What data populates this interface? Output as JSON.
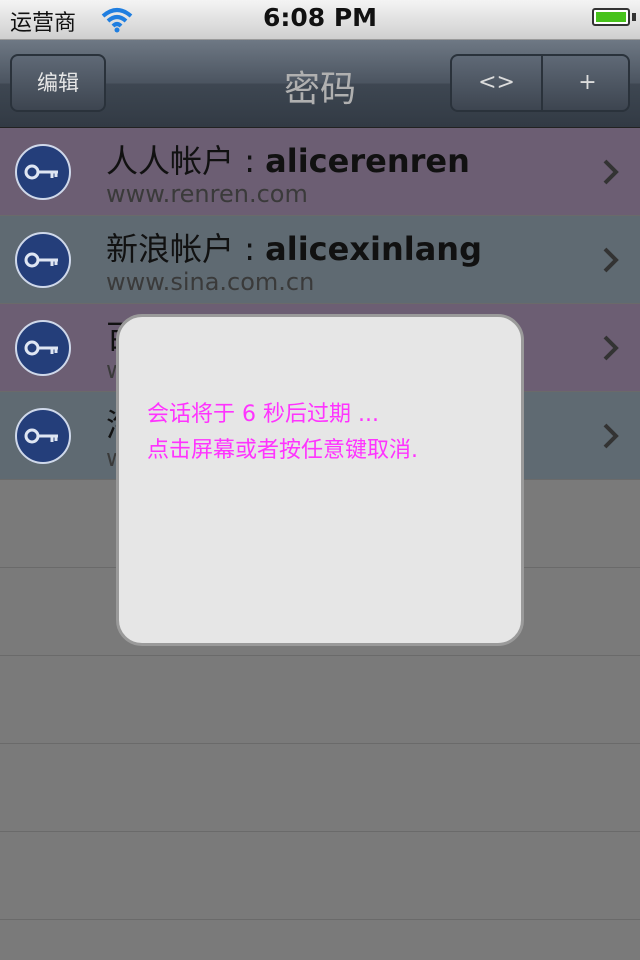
{
  "status_bar": {
    "carrier": "运营商",
    "time": "6:08 PM"
  },
  "nav": {
    "edit_label": "编辑",
    "title": "密码",
    "segment_left": "<>",
    "segment_right": "+"
  },
  "rows": [
    {
      "name": "人人帐户",
      "account": "alicerenren",
      "url": "www.renren.com"
    },
    {
      "name": "新浪帐户",
      "account": "alicexinlang",
      "url": "www.sina.com.cn"
    },
    {
      "name": "百",
      "account": "",
      "url": "w"
    },
    {
      "name": "淘",
      "account": "",
      "url": "w"
    }
  ],
  "alert": {
    "line1": "会话将于 6 秒后过期 ...",
    "line2": "点击屏幕或者按任意键取消."
  },
  "colors": {
    "row_purple": "#6c5e73",
    "row_blue": "#5f6a72",
    "alert_text": "#ff33ff"
  }
}
